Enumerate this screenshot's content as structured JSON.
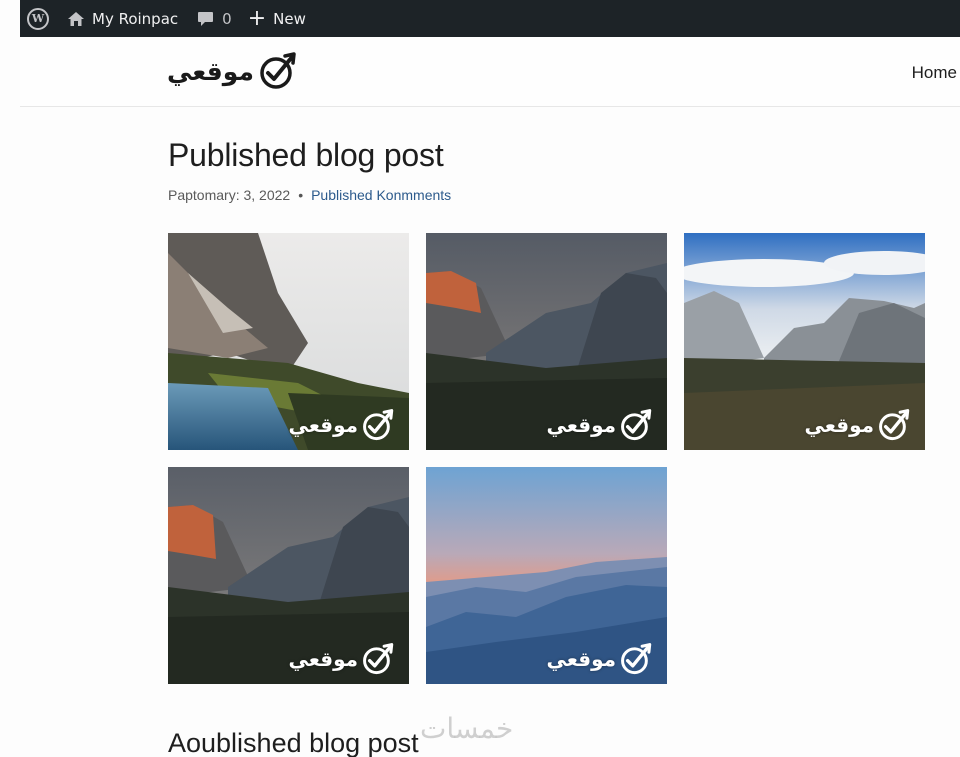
{
  "admin_bar": {
    "site_name": "My Roinpac",
    "comment_count": "0",
    "new_label": "New",
    "icons": [
      "wordpress-icon",
      "home-icon",
      "comment-icon",
      "plus-icon"
    ]
  },
  "header": {
    "brand_text": "موقعي",
    "nav": [
      {
        "label": "Home"
      }
    ]
  },
  "post": {
    "title": "Published blog post",
    "date": "Paptomary: 3, 2022",
    "separator": "•",
    "comments_link": "Published Konmments"
  },
  "gallery": {
    "watermark_text": "موقعي",
    "images": [
      {
        "scene": "waterfall-cliff-over-blue-pool"
      },
      {
        "scene": "valley-with-sunlit-cliff"
      },
      {
        "scene": "valley-under-blue-sky"
      },
      {
        "scene": "valley-with-sunlit-cliff"
      },
      {
        "scene": "mountains-at-sunset"
      }
    ]
  },
  "next_post": {
    "title": "Aoublished blog post"
  },
  "site_watermark": "خمسات",
  "colors": {
    "admin_bar_bg": "#1d2327",
    "link": "#2c5a8c",
    "text": "#1e1e1e"
  }
}
